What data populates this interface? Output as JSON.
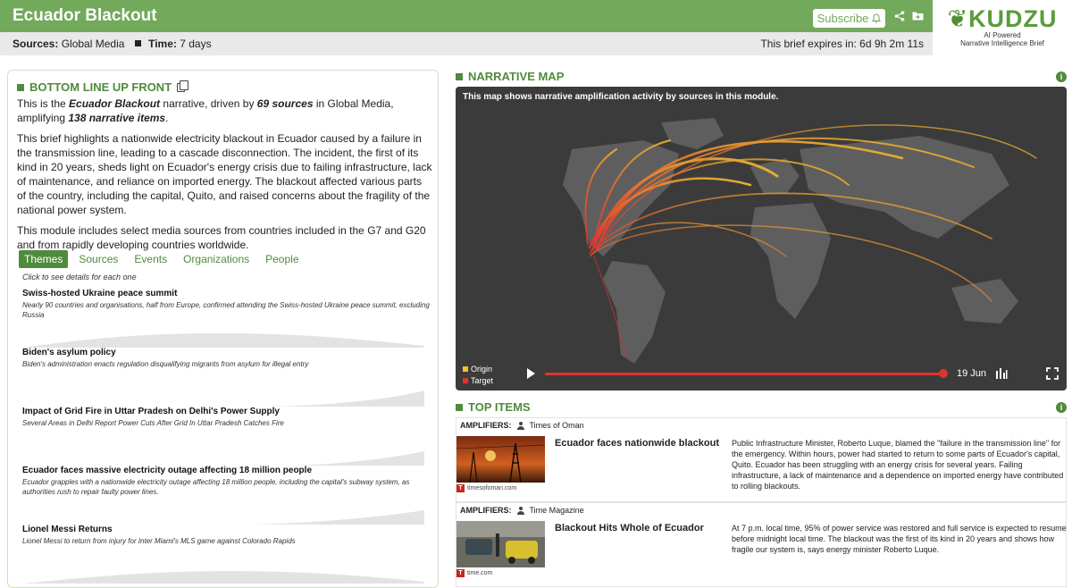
{
  "header": {
    "title": "Ecuador Blackout",
    "subscribe_label": "Subscribe",
    "sources_label": "Sources:",
    "sources_value": "Global Media",
    "time_label": "Time:",
    "time_value": "7 days",
    "expires_text": "This brief expires in: 6d 9h 2m 11s"
  },
  "logo": {
    "word": "KUDZU",
    "tagline1": "AI Powered",
    "tagline2": "Narrative Intelligence Brief"
  },
  "bluf": {
    "heading": "BOTTOM LINE UP FRONT",
    "p1_a": "This is the ",
    "p1_name": "Ecuador Blackout",
    "p1_b": " narrative, driven by ",
    "p1_sources": "69 sources",
    "p1_c": " in Global Media, amplifying ",
    "p1_items": "138 narrative items",
    "p1_d": ".",
    "p2": "This brief highlights a nationwide electricity blackout in Ecuador caused by a failure in the transmission line, leading to a cascade disconnection. The incident, the first of its kind in 20 years, sheds light on Ecuador's energy crisis due to failing infrastructure, lack of maintenance, and reliance on imported energy. The blackout affected various parts of the country, including the capital, Quito, and raised concerns about the fragility of the national power system.",
    "p3": "This module includes select media sources from countries included in the G7 and G20 and from rapidly developing countries worldwide."
  },
  "tabs": {
    "items": [
      "Themes",
      "Sources",
      "Events",
      "Organizations",
      "People"
    ],
    "active": "Themes",
    "hint": "Click to see details for each one"
  },
  "themes": [
    {
      "title": "Swiss-hosted Ukraine peace summit",
      "desc": "Nearly 90 countries and organisations, half from Europe, confirmed attending the Swiss-hosted Ukraine peace summit, excluding Russia",
      "trend": "hill"
    },
    {
      "title": "Biden's asylum policy",
      "desc": "Biden's administration enacts regulation disqualifying migrants from asylum for illegal entry",
      "trend": "rise"
    },
    {
      "title": "Impact of Grid Fire in Uttar Pradesh on Delhi's Power Supply",
      "desc": "Several Areas in Delhi Report Power Cuts After Grid In Uttar Pradesh Catches Fire",
      "trend": "rise"
    },
    {
      "title": "Ecuador faces massive electricity outage affecting 18 million people",
      "desc": "Ecuador grapples with a nationwide electricity outage affecting 18 million people, including the capital's subway system, as authorities rush to repair faulty power lines.",
      "trend": "rise"
    },
    {
      "title": "Lionel Messi Returns",
      "desc": "Lionel Messi to return from injury for Inter Miami's MLS game against Colorado Rapids",
      "trend": "hill"
    }
  ],
  "map": {
    "heading": "NARRATIVE MAP",
    "caption": "This map shows narrative amplification activity by sources in this module.",
    "legend_origin": "Origin",
    "legend_target": "Target",
    "origin_color": "#f2c230",
    "target_color": "#e0332c",
    "date": "19 Jun"
  },
  "top_items": {
    "heading": "TOP ITEMS",
    "amplifiers_label": "AMPLIFIERS:",
    "items": [
      {
        "amplifier": "Times of Oman",
        "headline": "Ecuador faces nationwide blackout",
        "source": "timesofoman.com",
        "summary": "Public Infrastructure Minister, Roberto Luque, blamed the \"failure in the transmission line\" for the emergency. Within hours, power had started to return to some parts of Ecuador's capital, Quito. Ecuador has been struggling with an energy crisis for several years. Failing infrastructure, a lack of maintenance and a dependence on imported energy have contributed to rolling blackouts."
      },
      {
        "amplifier": "Time Magazine",
        "headline": "Blackout Hits Whole of Ecuador",
        "source": "time.com",
        "summary": "At 7 p.m. local time, 95% of power service was restored and full service is expected to resume before midnight local time. The blackout was the first of its kind in 20 years and shows how fragile our system is, says energy minister Roberto Luque."
      }
    ]
  }
}
